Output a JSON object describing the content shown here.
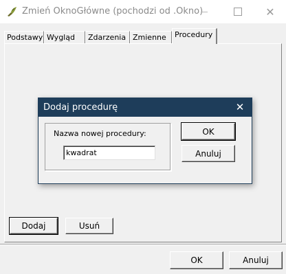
{
  "window": {
    "title": "Zmień OknoGłówne (pochodzi od .Okno)",
    "icon": "app-icon",
    "controls": {
      "minimize_icon": "minimize-icon",
      "maximize_icon": "maximize-icon",
      "close_glyph": "✕"
    }
  },
  "tabs": [
    {
      "label": "Podstawy",
      "active": false
    },
    {
      "label": "Wygląd",
      "active": false
    },
    {
      "label": "Zdarzenia",
      "active": false
    },
    {
      "label": "Zmienne",
      "active": false
    },
    {
      "label": "Procedury",
      "active": true
    }
  ],
  "panel": {
    "add_label": "Dodaj",
    "remove_label": "Usuń"
  },
  "footer": {
    "ok_label": "OK",
    "cancel_label": "Anuluj"
  },
  "dialog": {
    "title": "Dodaj procedurę",
    "close_glyph": "✕",
    "field_label": "Nazwa nowej procedury:",
    "field_value": "kwadrat",
    "ok_label": "OK",
    "cancel_label": "Anuluj"
  },
  "colors": {
    "dialog_titlebar": "#1e3d5a",
    "window_bg": "#f0f0f0",
    "title_text": "#8a8a8a"
  }
}
